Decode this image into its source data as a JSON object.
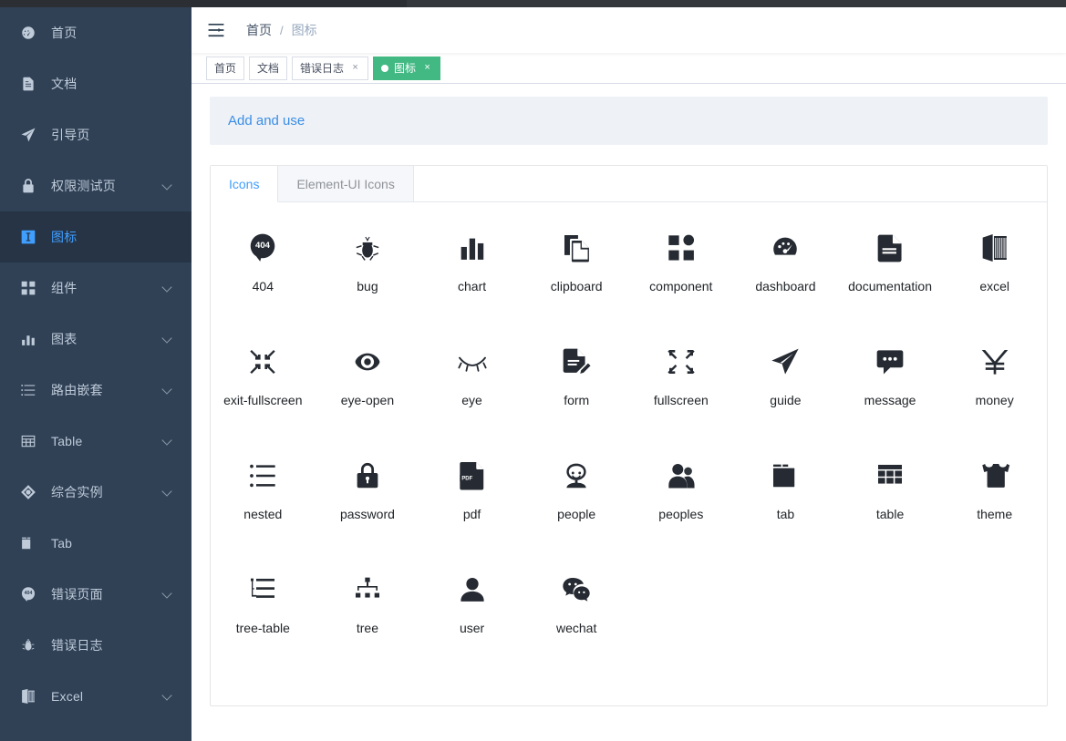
{
  "sidebar": {
    "items": [
      {
        "label": "首页",
        "icon": "dashboard-icon",
        "has_arrow": false,
        "active": false
      },
      {
        "label": "文档",
        "icon": "documentation-icon",
        "has_arrow": false,
        "active": false
      },
      {
        "label": "引导页",
        "icon": "guide-icon",
        "has_arrow": false,
        "active": false
      },
      {
        "label": "权限测试页",
        "icon": "lock-icon",
        "has_arrow": true,
        "active": false
      },
      {
        "label": "图标",
        "icon": "icon-icon",
        "has_arrow": false,
        "active": true
      },
      {
        "label": "组件",
        "icon": "component-icon",
        "has_arrow": true,
        "active": false
      },
      {
        "label": "图表",
        "icon": "chart-icon",
        "has_arrow": true,
        "active": false
      },
      {
        "label": "路由嵌套",
        "icon": "nested-icon",
        "has_arrow": true,
        "active": false
      },
      {
        "label": "Table",
        "icon": "table-icon",
        "has_arrow": true,
        "active": false
      },
      {
        "label": "综合实例",
        "icon": "example-icon",
        "has_arrow": true,
        "active": false
      },
      {
        "label": "Tab",
        "icon": "tab-icon",
        "has_arrow": false,
        "active": false
      },
      {
        "label": "错误页面",
        "icon": "404-icon",
        "has_arrow": true,
        "active": false
      },
      {
        "label": "错误日志",
        "icon": "bug-icon",
        "has_arrow": false,
        "active": false
      },
      {
        "label": "Excel",
        "icon": "excel-icon",
        "has_arrow": true,
        "active": false
      }
    ]
  },
  "navbar": {
    "hamburger_icon": "hamburger-icon",
    "breadcrumb": [
      {
        "label": "首页"
      },
      {
        "label": "图标"
      }
    ],
    "breadcrumb_separator": "/"
  },
  "tags_view": {
    "tags": [
      {
        "label": "首页",
        "closable": false,
        "active": false
      },
      {
        "label": "文档",
        "closable": false,
        "active": false
      },
      {
        "label": "错误日志",
        "closable": true,
        "active": false
      },
      {
        "label": "图标",
        "closable": true,
        "active": true
      }
    ],
    "close_glyph": "×"
  },
  "notice": {
    "text": "Add and use"
  },
  "tabs": {
    "items": [
      {
        "label": "Icons",
        "active": true
      },
      {
        "label": "Element-UI Icons",
        "active": false
      }
    ]
  },
  "icons": {
    "color": "#262b33",
    "items": [
      {
        "name": "404"
      },
      {
        "name": "bug"
      },
      {
        "name": "chart"
      },
      {
        "name": "clipboard"
      },
      {
        "name": "component"
      },
      {
        "name": "dashboard"
      },
      {
        "name": "documentation"
      },
      {
        "name": "excel"
      },
      {
        "name": "exit-fullscreen"
      },
      {
        "name": "eye-open"
      },
      {
        "name": "eye"
      },
      {
        "name": "form"
      },
      {
        "name": "fullscreen"
      },
      {
        "name": "guide"
      },
      {
        "name": "message"
      },
      {
        "name": "money"
      },
      {
        "name": "nested"
      },
      {
        "name": "password"
      },
      {
        "name": "pdf"
      },
      {
        "name": "people"
      },
      {
        "name": "peoples"
      },
      {
        "name": "tab"
      },
      {
        "name": "table"
      },
      {
        "name": "theme"
      },
      {
        "name": "tree-table"
      },
      {
        "name": "tree"
      },
      {
        "name": "user"
      },
      {
        "name": "wechat"
      }
    ]
  },
  "theme": {
    "sidebar_bg": "#304156",
    "sidebar_active_bg": "#263445",
    "accent_blue": "#409eff",
    "tag_active_green": "#42b983",
    "notice_bg": "#eef1f6"
  }
}
